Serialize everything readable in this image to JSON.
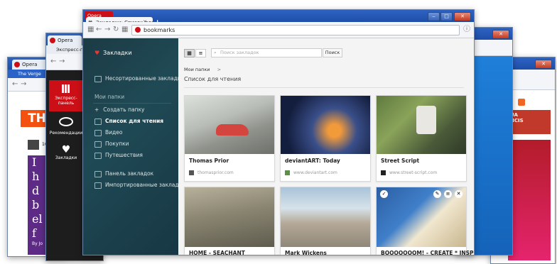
{
  "colors": {
    "opera_red": "#cc0f16",
    "sidebar_dark": "#1f4a55",
    "titlebar_blue": "#2f63c4"
  },
  "back_window_left": {
    "tab": "Opera",
    "site_tab": "The Verge",
    "logo": "TH",
    "letters": [
      "I",
      "h",
      "d",
      "b",
      "el",
      "f"
    ],
    "byline": "By Jo",
    "small": "10"
  },
  "speed_dial_window": {
    "tab": "Opera",
    "tab2": "Экспресс-пан",
    "items": [
      {
        "label": "Экспресс-панель",
        "icon": "grid-icon"
      },
      {
        "label": "Рекомендации",
        "icon": "eye-icon"
      },
      {
        "label": "Закладки",
        "icon": "heart-icon"
      }
    ]
  },
  "back_window_right": {
    "tab": "Opera",
    "lines": [
      "UA",
      "NCIS"
    ]
  },
  "main_window": {
    "tab_title": "Закладки: Список для чте",
    "titlebar_label": "Opera",
    "address": "bookmarks",
    "sidebar": {
      "header": "Закладки",
      "unsorted": "Несортированные закладки",
      "my_folders": "Мои папки",
      "create_folder": "Создать папку",
      "folders": [
        "Список для чтения",
        "Видео",
        "Покупки",
        "Путешествия"
      ],
      "bookmarks_bar": "Панель закладок",
      "imported": "Импортированные закладки"
    },
    "search": {
      "placeholder": "Поиск закладок",
      "button": "Поиск"
    },
    "breadcrumb": {
      "root": "Мои папки",
      "sep": ">",
      "current": "Список для чтения"
    },
    "cards": [
      {
        "title": "Thomas Prior",
        "url": "thomasprior.com"
      },
      {
        "title": "deviantART: Today",
        "url": "www.deviantart.com"
      },
      {
        "title": "Street Script",
        "url": "www.street-script.com"
      },
      {
        "title": "HOME - SEACHANT",
        "url": ""
      },
      {
        "title": "Mark Wickens",
        "url": ""
      },
      {
        "title": "BOOOOOOOM! - CREATE * INSPIRE",
        "url": ""
      }
    ]
  }
}
